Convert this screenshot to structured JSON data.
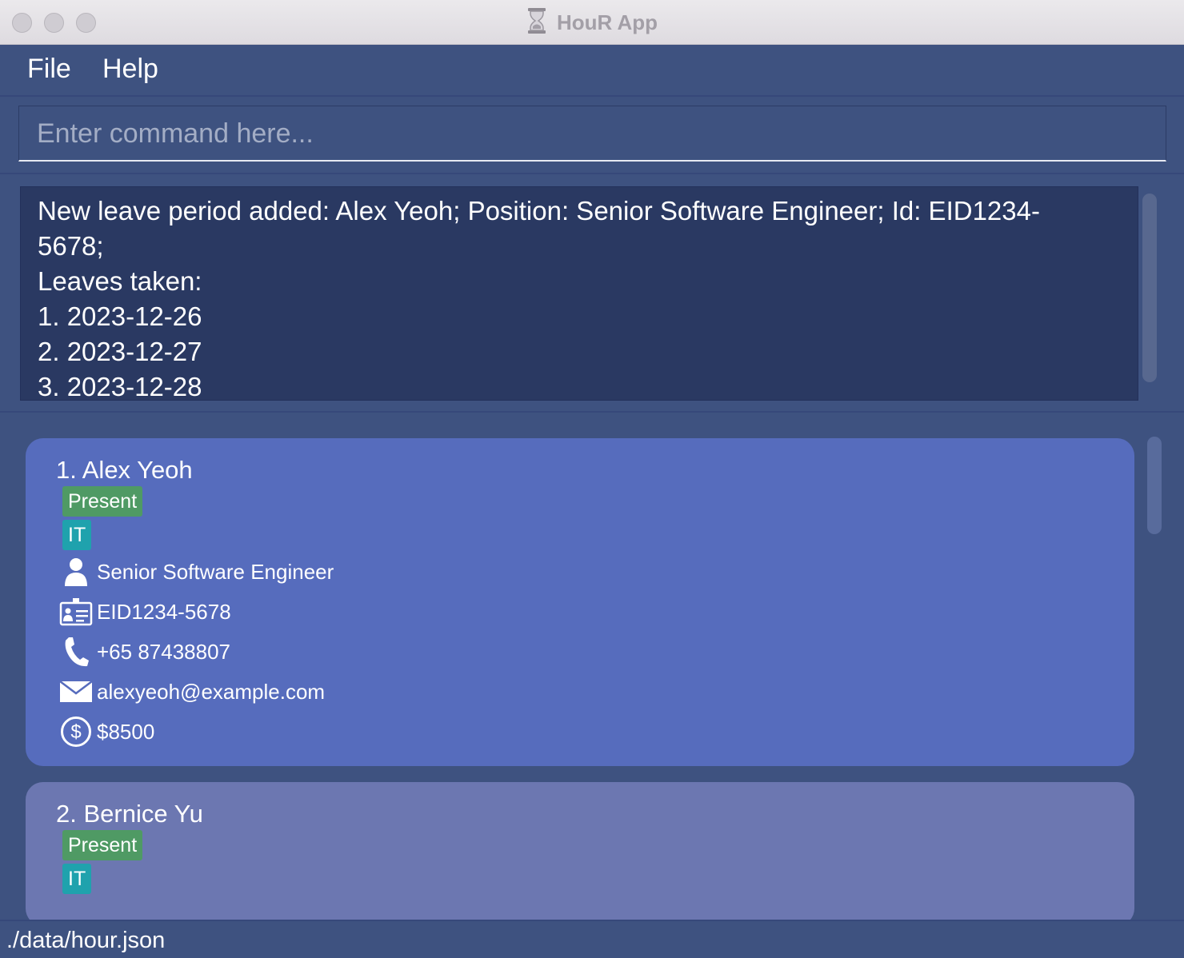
{
  "window": {
    "title": "HouR App"
  },
  "menu": {
    "file": "File",
    "help": "Help"
  },
  "command": {
    "placeholder": "Enter command here...",
    "value": ""
  },
  "result": {
    "text": "New leave period added: Alex Yeoh; Position: Senior Software Engineer; Id: EID1234-5678;\nLeaves taken:\n1. 2023-12-26\n2. 2023-12-27\n3. 2023-12-28"
  },
  "employees": [
    {
      "index_name": "1.  Alex Yeoh",
      "status": "Present",
      "department": "IT",
      "position": "Senior Software Engineer",
      "id": "EID1234-5678",
      "phone": "+65 87438807",
      "email": "alexyeoh@example.com",
      "salary": "$8500"
    },
    {
      "index_name": "2.  Bernice Yu",
      "status": "Present",
      "department": "IT"
    }
  ],
  "status_bar": {
    "path": "./data/hour.json"
  },
  "colors": {
    "background": "#3e5280",
    "result_box": "#2a3962",
    "card_selected": "#566cbd",
    "card": "#6c77b1",
    "tag_present": "#4f9a64",
    "tag_department": "#1fa2ad"
  },
  "icons": {
    "title": "hourglass-icon",
    "position": "person-icon",
    "id": "id-card-icon",
    "phone": "phone-icon",
    "email": "envelope-icon",
    "salary": "dollar-icon"
  }
}
